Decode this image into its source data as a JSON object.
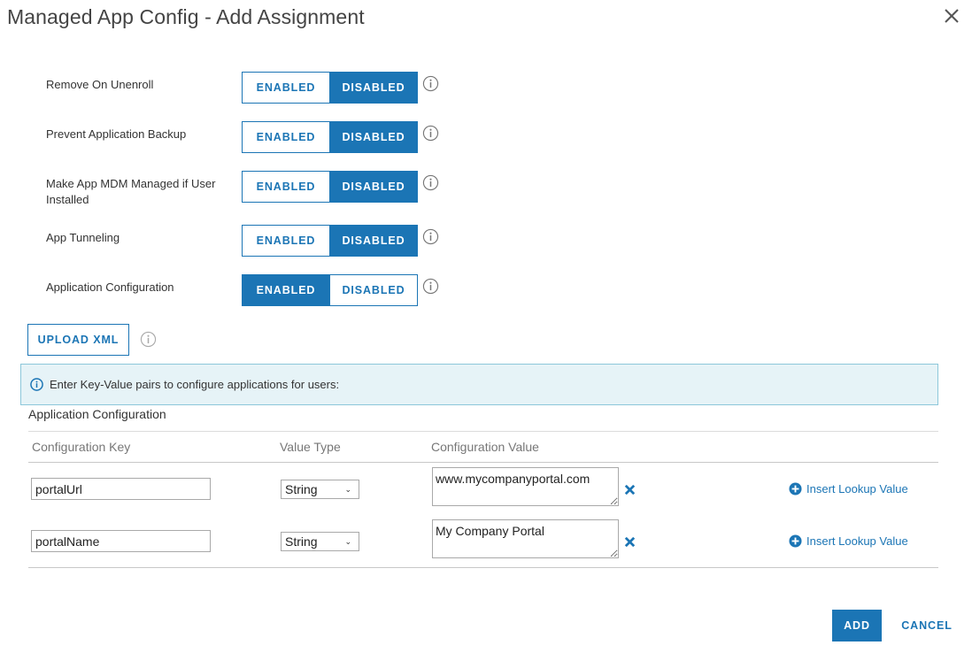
{
  "dialog": {
    "title": "Managed App Config - Add Assignment"
  },
  "toggles": [
    {
      "label": "Remove On Unenroll",
      "enabled_label": "ENABLED",
      "disabled_label": "DISABLED",
      "selected": "DISABLED"
    },
    {
      "label": "Prevent Application Backup",
      "enabled_label": "ENABLED",
      "disabled_label": "DISABLED",
      "selected": "DISABLED"
    },
    {
      "label": "Make App MDM Managed if User Installed",
      "enabled_label": "ENABLED",
      "disabled_label": "DISABLED",
      "selected": "DISABLED"
    },
    {
      "label": "App Tunneling",
      "enabled_label": "ENABLED",
      "disabled_label": "DISABLED",
      "selected": "DISABLED"
    },
    {
      "label": "Application Configuration",
      "enabled_label": "ENABLED",
      "disabled_label": "DISABLED",
      "selected": "ENABLED"
    }
  ],
  "upload": {
    "label": "UPLOAD XML"
  },
  "banner": {
    "text": "Enter Key-Value pairs to configure applications for users:"
  },
  "config": {
    "section_label": "Application Configuration",
    "columns": [
      "Configuration Key",
      "Value Type",
      "Configuration Value"
    ],
    "rows": [
      {
        "key": "portalUrl",
        "type": "String",
        "value": "www.mycompanyportal.com",
        "lookup_label": "Insert Lookup Value"
      },
      {
        "key": "portalName",
        "type": "String",
        "value": "My Company Portal",
        "lookup_label": "Insert Lookup Value"
      }
    ]
  },
  "actions": {
    "add_label": "ADD",
    "cancel_label": "CANCEL"
  },
  "colors": {
    "accent": "#1b75b5",
    "banner_bg": "#e6f3f7",
    "banner_border": "#8cc7da"
  }
}
